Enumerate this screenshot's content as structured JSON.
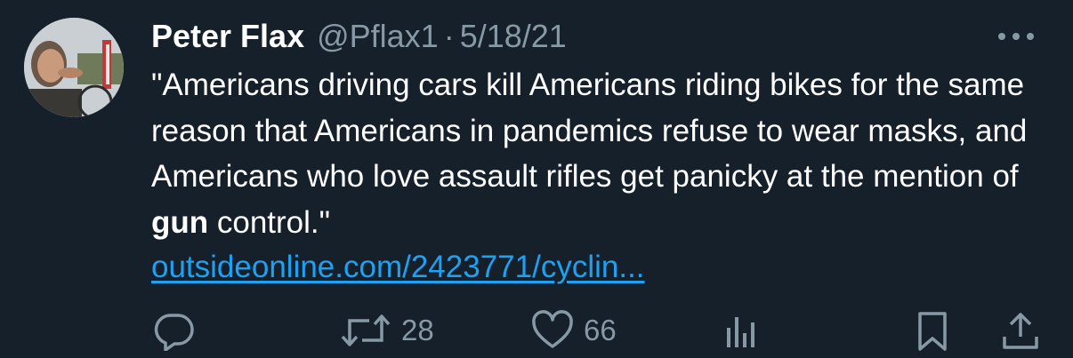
{
  "tweet": {
    "name": "Peter Flax",
    "handle": "@Pflax1",
    "separator": "·",
    "date": "5/18/21",
    "text_before": "\"Americans driving cars kill Americans riding bikes for the same reason that Americans in pandemics refuse to wear masks, and Americans who love assault rifles get panicky at the mention of ",
    "text_bold": "gun",
    "text_after": " control.\"",
    "link": "outsideonline.com/2423771/cyclin..."
  },
  "actions": {
    "retweets": "28",
    "likes": "66"
  },
  "icons": [
    "avatar",
    "more-icon",
    "reply-icon",
    "retweet-icon",
    "like-icon",
    "analytics-icon",
    "bookmark-icon",
    "share-icon"
  ],
  "colors": {
    "background": "#15202b",
    "text": "#ffffff",
    "secondary": "#8899a6",
    "link": "#1da1f2"
  }
}
